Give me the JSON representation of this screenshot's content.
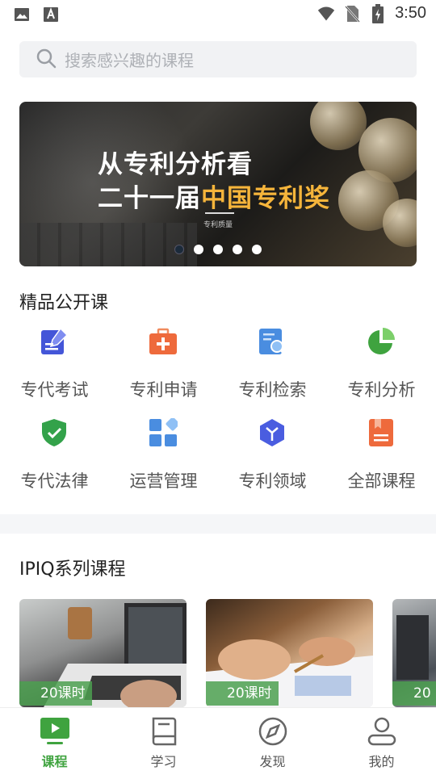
{
  "status_bar": {
    "time": "3:50",
    "icons": [
      "image-icon",
      "font-download-icon",
      "wifi-icon",
      "no-sim-icon",
      "battery-charging-icon"
    ]
  },
  "search": {
    "placeholder": "搜索感兴趣的课程"
  },
  "banner": {
    "line1": "从专利分析看",
    "line2_prefix": "二十一届",
    "line2_highlight": "中国专利奖",
    "caption": "专利质量",
    "dot_count": 5,
    "active_dot": 0,
    "highlight_color": "#f6b53b"
  },
  "section_open_courses": {
    "title": "精品公开课"
  },
  "categories": [
    {
      "label": "专代考试",
      "icon": "edit-document-icon"
    },
    {
      "label": "专利申请",
      "icon": "medical-kit-icon"
    },
    {
      "label": "专利检索",
      "icon": "search-document-icon"
    },
    {
      "label": "专利分析",
      "icon": "pie-chart-icon"
    },
    {
      "label": "专代法律",
      "icon": "shield-check-icon"
    },
    {
      "label": "运营管理",
      "icon": "grid-apps-icon"
    },
    {
      "label": "专利领域",
      "icon": "cube-icon"
    },
    {
      "label": "全部课程",
      "icon": "book-icon"
    }
  ],
  "section_ipiq": {
    "title": "IPIQ系列课程"
  },
  "course_cards": [
    {
      "badge": "20课时"
    },
    {
      "badge": "20课时"
    },
    {
      "badge": "20"
    }
  ],
  "tabs": [
    {
      "label": "课程",
      "icon": "play-screen-icon",
      "active": true
    },
    {
      "label": "学习",
      "icon": "notebook-icon",
      "active": false
    },
    {
      "label": "发现",
      "icon": "compass-icon",
      "active": false
    },
    {
      "label": "我的",
      "icon": "user-icon",
      "active": false
    }
  ],
  "colors": {
    "accent_green": "#3fa33f",
    "badge_green": "#4ca050"
  }
}
